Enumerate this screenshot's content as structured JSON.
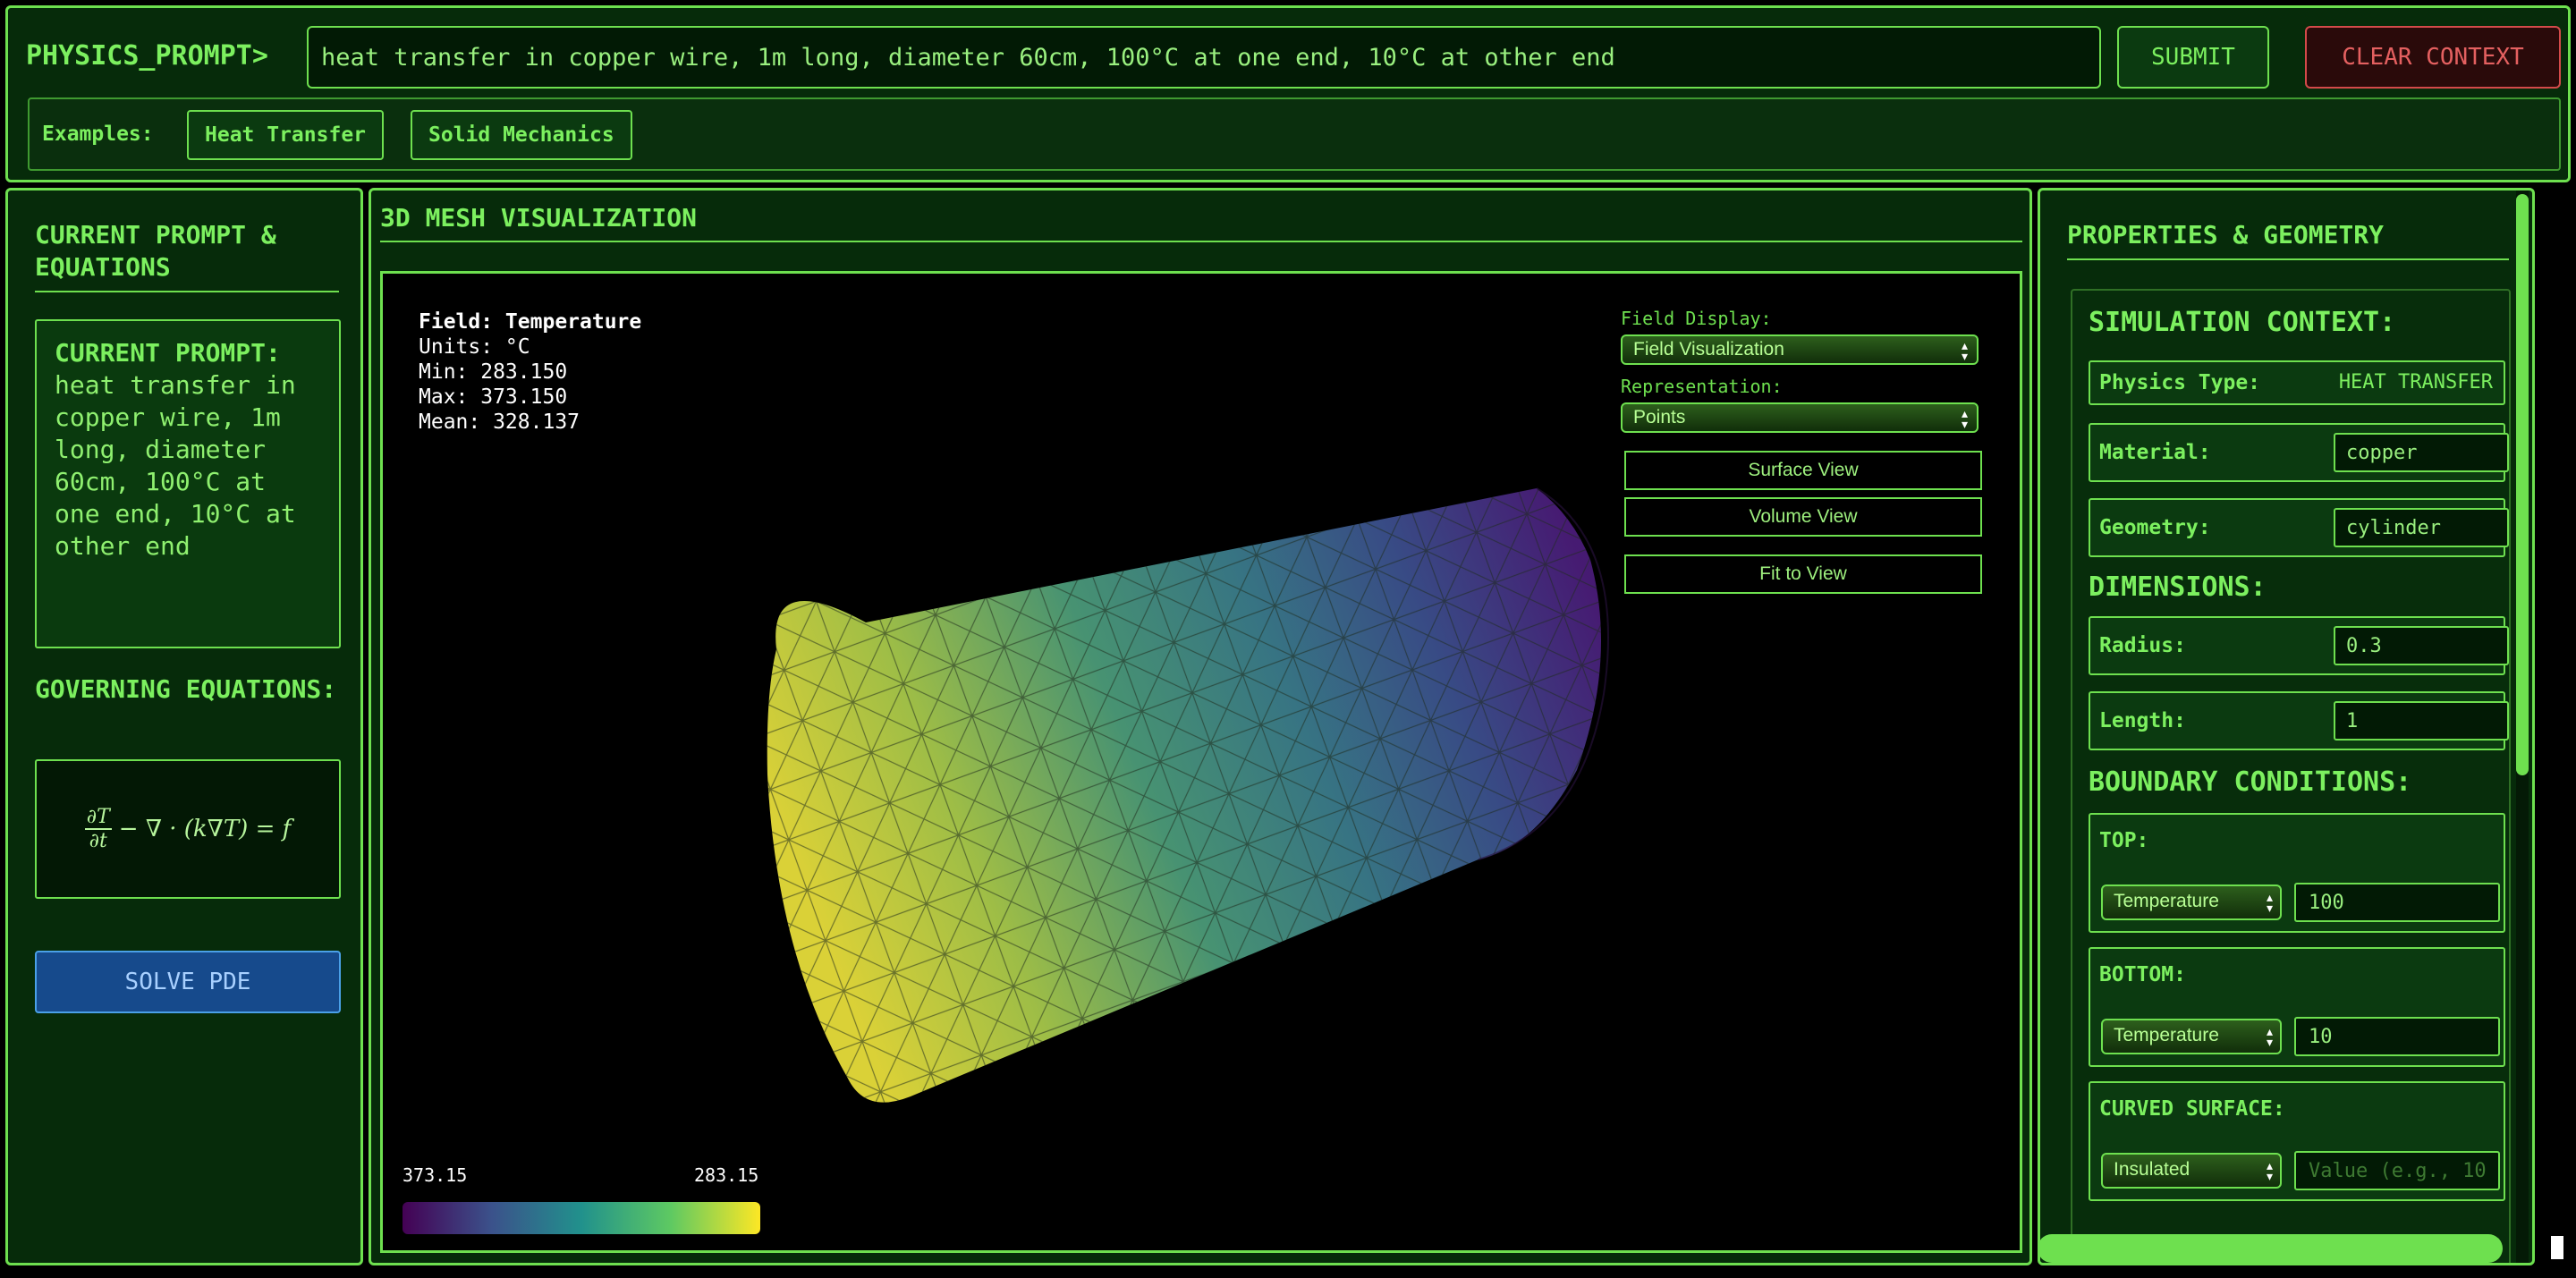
{
  "header": {
    "prompt_label": "PHYSICS_PROMPT>",
    "prompt_value": "heat transfer in copper wire, 1m long, diameter 60cm, 100°C at one end, 10°C at other end",
    "submit_label": "SUBMIT",
    "clear_label": "CLEAR CONTEXT",
    "examples_label": "Examples:",
    "examples": [
      "Heat Transfer",
      "Solid Mechanics"
    ]
  },
  "left": {
    "title": "CURRENT PROMPT & EQUATIONS",
    "current_prompt_label": "CURRENT PROMPT:",
    "current_prompt_text": "heat transfer in copper wire, 1m long, diameter 60cm, 100°C at one end, 10°C at other end",
    "governing_title": "GOVERNING EQUATIONS:",
    "equation_numerator": "∂T",
    "equation_denominator": "∂t",
    "equation_rest": "− ∇ · (k∇T) = f",
    "solve_label": "SOLVE PDE"
  },
  "center": {
    "title": "3D MESH VISUALIZATION",
    "field_label": "Field: Temperature",
    "units": "Units: °C",
    "min": "Min: 283.150",
    "max": "Max: 373.150",
    "mean": "Mean: 328.137",
    "field_display_label": "Field Display:",
    "field_display_value": "Field Visualization",
    "representation_label": "Representation:",
    "representation_value": "Points",
    "surface_view": "Surface View",
    "volume_view": "Volume View",
    "fit_view": "Fit to View",
    "colorbar_left": "373.15",
    "colorbar_right": "283.15",
    "colormap": [
      "#440154",
      "#3b528b",
      "#21918c",
      "#5ec962",
      "#fde725"
    ]
  },
  "right": {
    "title": "PROPERTIES & GEOMETRY",
    "sim_context": "SIMULATION CONTEXT:",
    "physics_type_label": "Physics Type:",
    "physics_type_value": "HEAT TRANSFER",
    "material_label": "Material:",
    "material_value": "copper",
    "geometry_label": "Geometry:",
    "geometry_value": "cylinder",
    "dimensions": "DIMENSIONS:",
    "radius_label": "Radius:",
    "radius_value": "0.3",
    "length_label": "Length:",
    "length_value": "1",
    "boundary": "BOUNDARY CONDITIONS:",
    "top_label": "TOP:",
    "top_type": "Temperature",
    "top_value": "100",
    "bottom_label": "BOTTOM:",
    "bottom_type": "Temperature",
    "bottom_value": "10",
    "curved_label": "CURVED SURFACE:",
    "curved_type": "Insulated",
    "curved_placeholder": "Value (e.g., 10"
  },
  "colors": {
    "accent": "#6ee04f",
    "panel_bg": "#062b0a",
    "danger": "#d34a4a",
    "solve": "#164a8c"
  }
}
